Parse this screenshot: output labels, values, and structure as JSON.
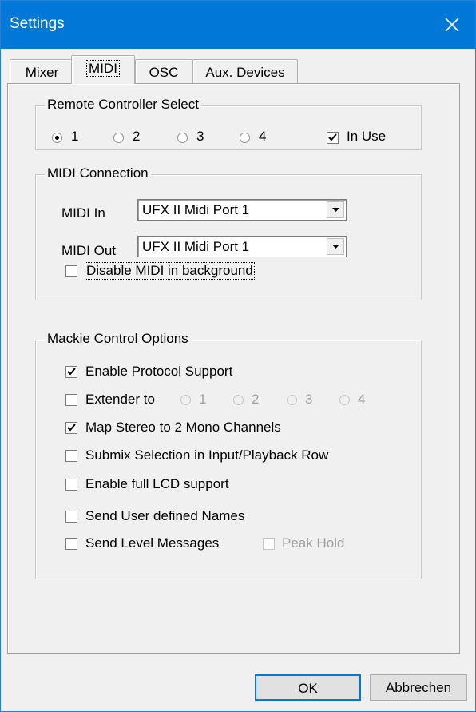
{
  "window": {
    "title": "Settings"
  },
  "tabs": [
    {
      "label": "Mixer"
    },
    {
      "label": "MIDI"
    },
    {
      "label": "OSC"
    },
    {
      "label": "Aux. Devices"
    }
  ],
  "remote": {
    "legend": "Remote Controller Select",
    "options": [
      "1",
      "2",
      "3",
      "4"
    ],
    "selected": "1",
    "in_use_label": "In Use",
    "in_use": true
  },
  "midi": {
    "legend": "MIDI Connection",
    "in_label": "MIDI In",
    "in_value": "UFX II Midi Port 1",
    "out_label": "MIDI Out",
    "out_value": "UFX II Midi Port 1",
    "disable_label": "Disable MIDI in background",
    "disable": false
  },
  "mackie": {
    "legend": "Mackie Control Options",
    "enable_protocol": {
      "label": "Enable Protocol Support",
      "checked": true
    },
    "extender": {
      "label": "Extender to",
      "checked": false,
      "options": [
        "1",
        "2",
        "3",
        "4"
      ]
    },
    "map_stereo": {
      "label": "Map Stereo to 2 Mono Channels",
      "checked": true
    },
    "submix": {
      "label": "Submix Selection in Input/Playback Row",
      "checked": false
    },
    "lcd": {
      "label": "Enable full LCD support",
      "checked": false
    },
    "names": {
      "label": "Send User defined Names",
      "checked": false
    },
    "level": {
      "label": "Send Level Messages",
      "checked": false
    },
    "peak": {
      "label": "Peak Hold",
      "checked": false
    }
  },
  "buttons": {
    "ok": "OK",
    "cancel": "Abbrechen"
  }
}
